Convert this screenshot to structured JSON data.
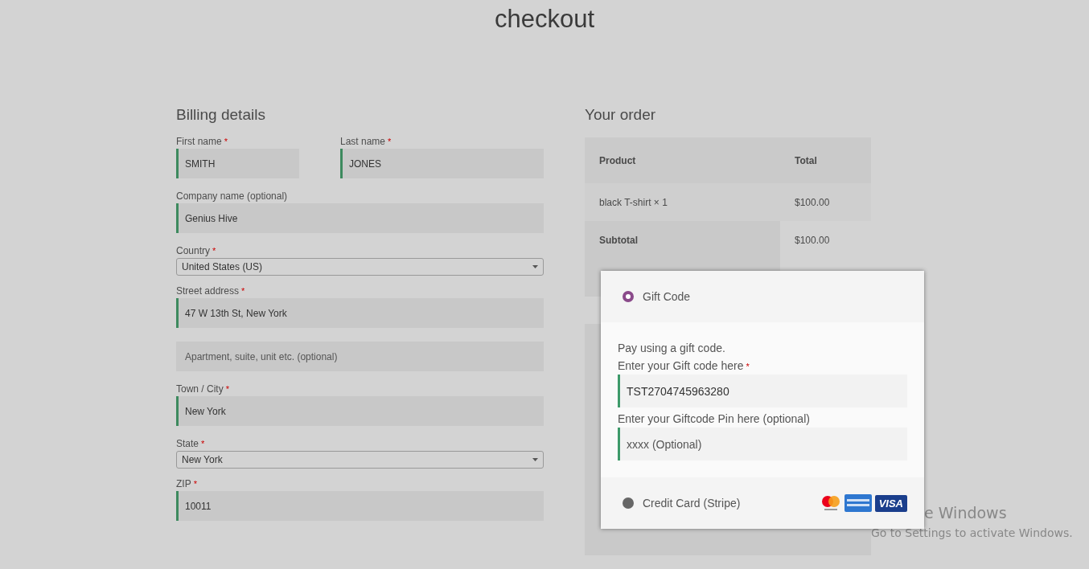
{
  "page": {
    "title": "checkout"
  },
  "billing": {
    "heading": "Billing details",
    "rows": [
      [
        {
          "kind": "text",
          "label": "First name",
          "mark": "*",
          "value": "SMITH"
        },
        {
          "kind": "text",
          "label": "Last name",
          "mark": "*",
          "value": "JONES"
        }
      ],
      [
        {
          "kind": "text",
          "label": "Company name (optional)",
          "value": "Genius Hive"
        }
      ],
      [
        {
          "kind": "select",
          "label": "Country",
          "mark": "*",
          "value": "United States (US)"
        }
      ],
      [
        {
          "kind": "text",
          "label": "Street address",
          "mark": "*",
          "value": "47 W 13th St, New York"
        }
      ],
      [
        {
          "kind": "text",
          "placeholder": "Apartment, suite, unit etc. (optional)"
        }
      ],
      [
        {
          "kind": "text",
          "label": "Town / City",
          "mark": "*",
          "value": "New York"
        }
      ],
      [
        {
          "kind": "select",
          "label": "State",
          "mark": "*",
          "value": "New York"
        }
      ],
      [
        {
          "kind": "text",
          "label": "ZIP",
          "mark": "*",
          "value": "10011"
        }
      ]
    ]
  },
  "order": {
    "heading": "Your order",
    "columns": [
      "Product",
      "Total"
    ],
    "rows": [
      {
        "kind": "item",
        "cells": [
          "black T-shirt  × 1",
          "$100.00"
        ]
      },
      {
        "kind": "subtotal",
        "cells": [
          "Subtotal",
          "$100.00"
        ]
      }
    ]
  },
  "payment": {
    "methods": [
      {
        "kind": "gift",
        "name": "Gift Code",
        "selected": true,
        "description": "Pay using a gift code.",
        "fields": [
          {
            "label": "Enter your Gift code here",
            "mark": "*",
            "value": "TST2704745963280"
          },
          {
            "label": "Enter your Giftcode Pin here (optional)",
            "placeholder": "xxxx (Optional)"
          }
        ]
      },
      {
        "kind": "card",
        "name": "Credit Card (Stripe)",
        "selected": false,
        "logos": [
          {
            "kind": "mastercard"
          },
          {
            "kind": "amex"
          },
          {
            "kind": "visa",
            "text": "VISA"
          }
        ]
      }
    ]
  },
  "os_notice": {
    "lines": [
      "e Windows",
      "Go to Settings to activate Windows."
    ]
  }
}
